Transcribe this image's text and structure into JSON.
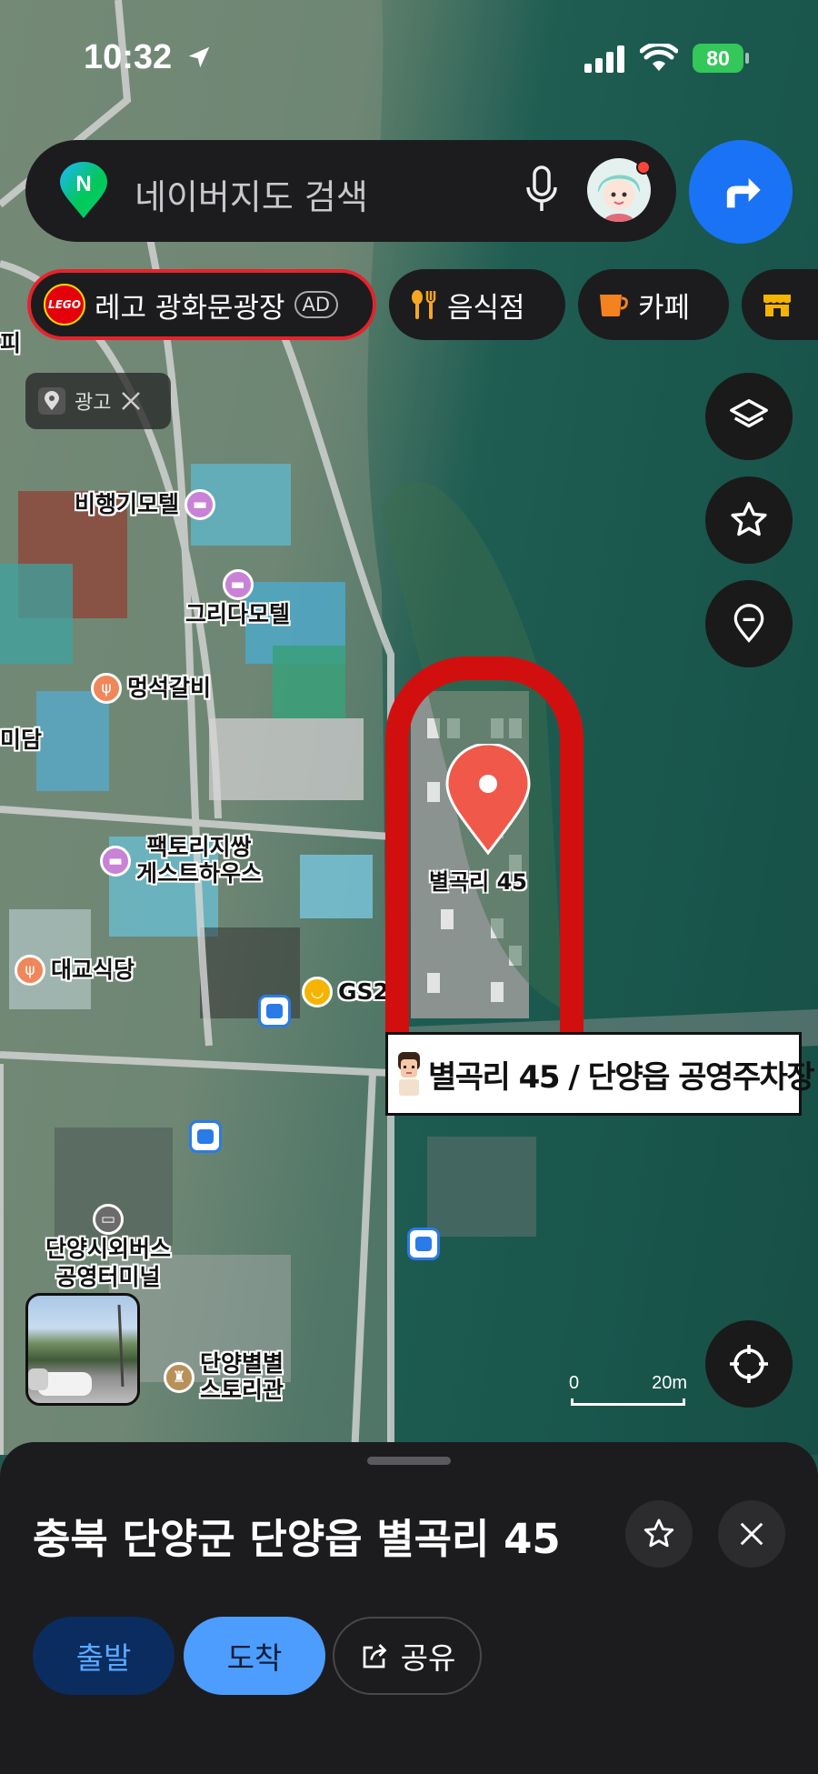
{
  "status": {
    "time": "10:32",
    "battery": "80"
  },
  "search": {
    "placeholder": "네이버지도 검색"
  },
  "chips": [
    {
      "label": "레고 광화문광장",
      "badge": "AD",
      "logo": "LEGO"
    },
    {
      "label": "음식점",
      "icon": "fork-knife-icon"
    },
    {
      "label": "카페",
      "icon": "coffee-cup-icon"
    },
    {
      "label": "",
      "icon": "store-icon"
    }
  ],
  "ad_notice": {
    "label": "광고"
  },
  "map_labels": {
    "edge_pi": "피",
    "edge_dam": "미담",
    "bihaenggi": "비행기모텔",
    "grida": "그리다모텔",
    "meongseok": "멍석갈비",
    "factory_line1": "팩토리지쌍",
    "factory_line2": "게스트하우스",
    "daegyo": "대교식당",
    "gs": "GS2",
    "terminal_line1": "단양시외버스",
    "terminal_line2": "공영터미널",
    "byeolbyeol_line1": "단양별별",
    "byeolbyeol_line2": "스토리관"
  },
  "marker": {
    "label": "별곡리 45"
  },
  "caption": {
    "text": "별곡리 45 / 단양읍 공영주차장"
  },
  "scale": {
    "start": "0",
    "end": "20m"
  },
  "sheet": {
    "address": "충북 단양군 단양읍 별곡리 45",
    "depart_label": "출발",
    "arrive_label": "도착",
    "share_label": "공유"
  },
  "colors": {
    "accent": "#1a73f5",
    "highlight": "#d20f0f",
    "marker": "#f0584a"
  }
}
